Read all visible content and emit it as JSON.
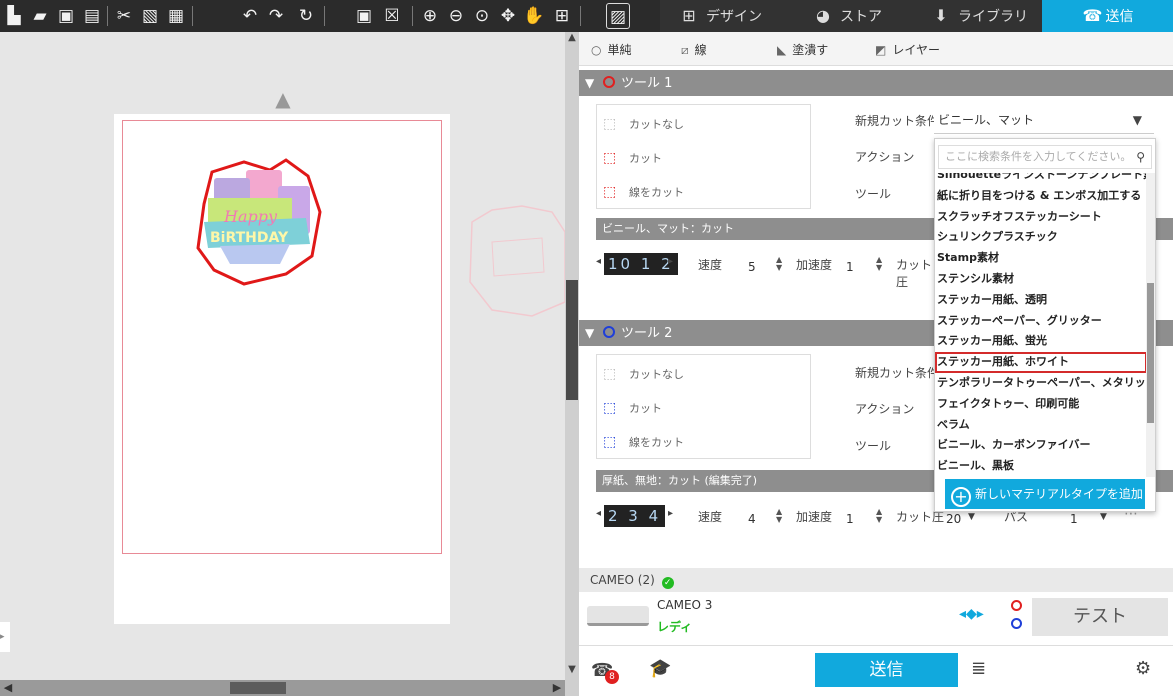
{
  "toolbar": {
    "icons": [
      "new-file-icon",
      "open-folder-icon",
      "save-icon",
      "print-icon",
      "cut-icon",
      "copy-icon",
      "paste-icon",
      "undo-icon",
      "redo-icon",
      "replicate-icon",
      "select-all-icon",
      "deselect-icon",
      "zoom-in-icon",
      "zoom-out-icon",
      "zoom-fit-icon",
      "move-icon",
      "pan-hand-icon",
      "fit-page-icon",
      "trace-icon"
    ]
  },
  "nav": {
    "design": "デザイン",
    "store": "ストア",
    "library": "ライブラリ",
    "send": "送信"
  },
  "subtabs": {
    "simple": "単純",
    "line": "線",
    "fill": "塗潰す",
    "layer": "レイヤー"
  },
  "tool1": {
    "header": "ツール 1",
    "ring_color": "#e02020",
    "options": [
      "カットなし",
      "カット",
      "線をカット"
    ],
    "new_cut_condition_label": "新規カット条件",
    "action_label": "アクション",
    "tool_label": "ツール",
    "material_bar": "ビニール、マット：カット",
    "digits": "10 1 2",
    "speed_label": "速度",
    "speed_value": "5",
    "accel_label": "加速度",
    "accel_value": "1",
    "force_label": "カット圧"
  },
  "tool2": {
    "header": "ツール 2",
    "ring_color": "#1f3fd8",
    "options": [
      "カットなし",
      "カット",
      "線をカット"
    ],
    "new_cut_condition_label": "新規カット条件",
    "action_label": "アクション",
    "tool_label": "ツール",
    "material_bar": "厚紙、無地：カット (編集完了)",
    "digits": "2 3 4",
    "speed_label": "速度",
    "speed_value": "4",
    "accel_label": "加速度",
    "accel_value": "1",
    "force_label": "カット圧",
    "force_value": "20",
    "passes_label": "パス",
    "passes_value": "1"
  },
  "dropdown": {
    "selected": "ビニール、マット",
    "search_placeholder": "ここに検索条件を入力してください。",
    "items": [
      "Silhouetteラインストーンテンプレート素材",
      "紙に折り目をつける & エンボス加工する",
      "スクラッチオフステッカーシート",
      "シュリンクプラスチック",
      "Stamp素材",
      "ステンシル素材",
      "ステッカー用紙、透明",
      "ステッカーペーパー、グリッター",
      "ステッカー用紙、蛍光",
      "ステッカー用紙、ホワイト",
      "テンポラリータトゥーペーパー、メタリック",
      "フェイクタトゥー、印刷可能",
      "ベラム",
      "ビニール、カーボンファイバー",
      "ビニール、黒板"
    ],
    "selected_index": 9,
    "add_label": "新しいマテリアルタイプを追加"
  },
  "machine": {
    "header": "CAMEO (2)",
    "name": "CAMEO 3",
    "status": "レディ",
    "status_color": "#22bb22",
    "test": "テスト"
  },
  "footer": {
    "send": "送信",
    "badge": "8"
  },
  "design": {
    "text_happy": "Happy",
    "text_birthday": "BiRTHDAY"
  }
}
